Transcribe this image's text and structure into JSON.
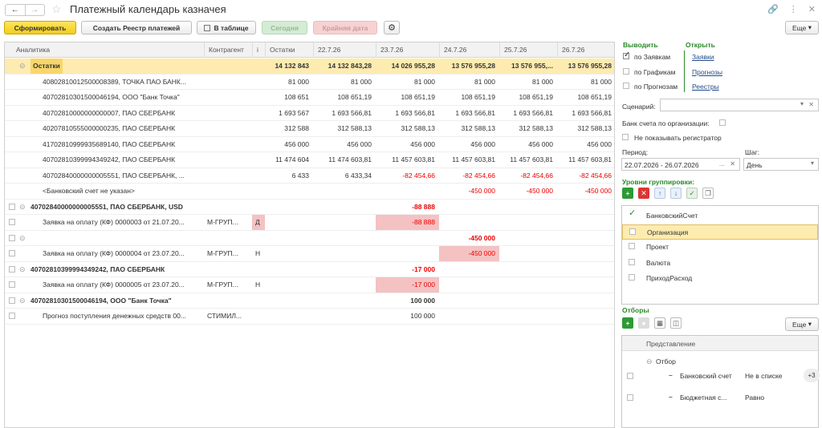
{
  "window": {
    "title": "Платежный календарь казначея",
    "more_label": "Еще"
  },
  "toolbar": {
    "form": "Сформировать",
    "create": "Создать Реестр платежей",
    "table": "В таблице",
    "today": "Сегодня",
    "deadline": "Крайняя дата"
  },
  "columns": [
    "Аналитика",
    "Контрагент",
    "i",
    "Остатки",
    "22.7.26",
    "23.7.26",
    "24.7.26",
    "25.7.26",
    "26.7.26"
  ],
  "rows": [
    {
      "a": "Остатки",
      "k": "",
      "i": "",
      "o": "14 132 843",
      "d1": "14 132 843,28",
      "d2": "14 026 955,28",
      "d3": "13 576 955,28",
      "d4": "13 576 955,...",
      "d5": "13 576 955,28"
    },
    {
      "a": "40802810012500008389, ТОЧКА ПАО БАНК...",
      "k": "",
      "i": "",
      "o": "81 000",
      "d1": "81 000",
      "d2": "81 000",
      "d3": "81 000",
      "d4": "81 000",
      "d5": "81 000"
    },
    {
      "a": "40702810301500046194, ООО \"Банк Точка\"",
      "k": "",
      "i": "",
      "o": "108 651",
      "d1": "108 651,19",
      "d2": "108 651,19",
      "d3": "108 651,19",
      "d4": "108 651,19",
      "d5": "108 651,19"
    },
    {
      "a": "40702810000000000007, ПАО СБЕРБАНК",
      "k": "",
      "i": "",
      "o": "1 693 567",
      "d1": "1 693 566,81",
      "d2": "1 693 566,81",
      "d3": "1 693 566,81",
      "d4": "1 693 566,81",
      "d5": "1 693 566,81"
    },
    {
      "a": "40207810555000000235, ПАО СБЕРБАНК",
      "k": "",
      "i": "",
      "o": "312 588",
      "d1": "312 588,13",
      "d2": "312 588,13",
      "d3": "312 588,13",
      "d4": "312 588,13",
      "d5": "312 588,13"
    },
    {
      "a": "41702810999935689140, ПАО СБЕРБАНК",
      "k": "",
      "i": "",
      "o": "456 000",
      "d1": "456 000",
      "d2": "456 000",
      "d3": "456 000",
      "d4": "456 000",
      "d5": "456 000"
    },
    {
      "a": "40702810399994349242, ПАО СБЕРБАНК",
      "k": "",
      "i": "",
      "o": "11 474 604",
      "d1": "11 474 603,81",
      "d2": "11 457 603,81",
      "d3": "11 457 603,81",
      "d4": "11 457 603,81",
      "d5": "11 457 603,81"
    },
    {
      "a": "40702840000000005551, ПАО СБЕРБАНК, ...",
      "k": "",
      "i": "",
      "o": "6 433",
      "d1": "6 433,34",
      "d2": "-82 454,66",
      "d3": "-82 454,66",
      "d4": "-82 454,66",
      "d5": "-82 454,66"
    },
    {
      "a": "<Банковский счет не указан>",
      "k": "",
      "i": "",
      "o": "",
      "d1": "",
      "d2": "",
      "d3": "-450 000",
      "d4": "-450 000",
      "d5": "-450 000"
    },
    {
      "a": "40702840000000005551, ПАО СБЕРБАНК, USD",
      "k": "",
      "i": "",
      "o": "",
      "d1": "",
      "d2": "-88 888",
      "d3": "",
      "d4": "",
      "d5": ""
    },
    {
      "a": "Заявка на оплату (КФ) 0000003 от 21.07.20...",
      "k": "М-ГРУП...",
      "i": "Д",
      "o": "",
      "d1": "",
      "d2": "-88 888",
      "d3": "",
      "d4": "",
      "d5": ""
    },
    {
      "a": "",
      "k": "",
      "i": "",
      "o": "",
      "d1": "",
      "d2": "",
      "d3": "-450 000",
      "d4": "",
      "d5": ""
    },
    {
      "a": "Заявка на оплату (КФ) 0000004 от 23.07.20...",
      "k": "М-ГРУП...",
      "i": "Н",
      "o": "",
      "d1": "",
      "d2": "",
      "d3": "-450 000",
      "d4": "",
      "d5": ""
    },
    {
      "a": "40702810399994349242, ПАО СБЕРБАНК",
      "k": "",
      "i": "",
      "o": "",
      "d1": "",
      "d2": "-17 000",
      "d3": "",
      "d4": "",
      "d5": ""
    },
    {
      "a": "Заявка на оплату (КФ) 0000005 от 23.07.20...",
      "k": "М-ГРУП...",
      "i": "Н",
      "o": "",
      "d1": "",
      "d2": "-17 000",
      "d3": "",
      "d4": "",
      "d5": ""
    },
    {
      "a": "40702810301500046194, ООО \"Банк Точка\"",
      "k": "",
      "i": "",
      "o": "",
      "d1": "",
      "d2": "100 000",
      "d3": "",
      "d4": "",
      "d5": ""
    },
    {
      "a": "Прогноз поступления денежных средств 00...",
      "k": "СТИМИЛ...",
      "i": "",
      "o": "",
      "d1": "",
      "d2": "100 000",
      "d3": "",
      "d4": "",
      "d5": ""
    }
  ],
  "right": {
    "show_title": "Выводить",
    "show_items": [
      "по Заявкам",
      "по Графикам",
      "по Прогнозам"
    ],
    "open_title": "Открыть",
    "open_links": [
      "Заявки",
      "Прогнозы",
      "Реестры"
    ],
    "scenario_label": "Сценарий:",
    "bank_label": "Банк счета по организации:",
    "hide_reg_label": "Не показывать регистратор",
    "period_label": "Период:",
    "period_value": "22.07.2026 - 26.07.2026",
    "step_label": "Шаг:",
    "step_value": "День",
    "group_title": "Уровни группировки:",
    "group_items": [
      "БанковскийСчет",
      "Организация",
      "Проект",
      "Валюта",
      "ПриходРасход"
    ],
    "filters_title": "Отборы",
    "filters_more": "Еще",
    "filters_col": "Представление",
    "filter_group": "Отбор",
    "filters": [
      {
        "name": "Банковский счет",
        "cond": "Не в списке",
        "badge": "+3"
      },
      {
        "name": "Бюджетная с...",
        "cond": "Равно",
        "badge": ""
      }
    ]
  },
  "colors": {
    "accent_yellow": "#f3cc1c",
    "highlight": "#fdebb0",
    "negative": "#e00000",
    "link": "#234a8a",
    "group_green": "#2a8a2a"
  }
}
